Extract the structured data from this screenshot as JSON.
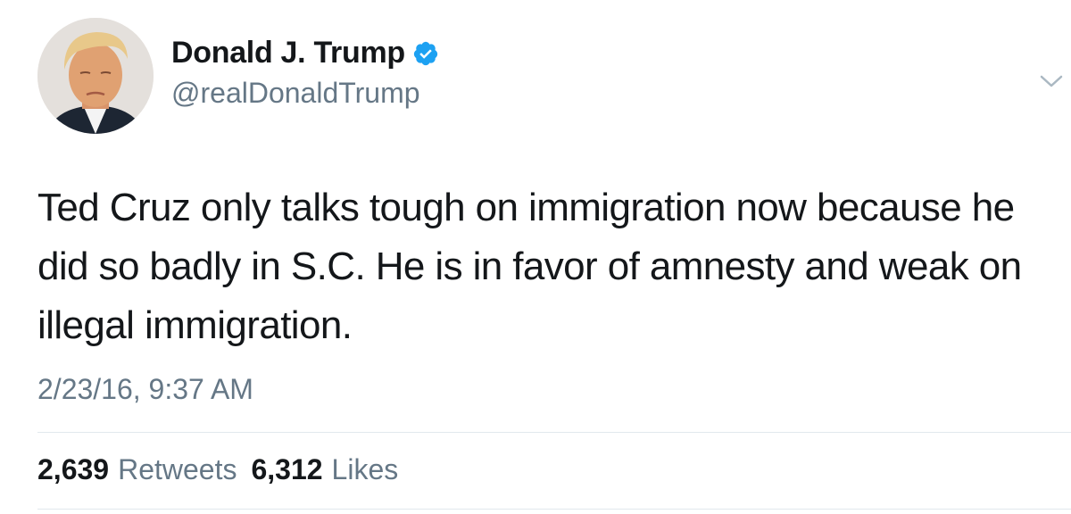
{
  "user": {
    "display_name": "Donald J. Trump",
    "handle": "@realDonaldTrump",
    "verified_icon": "verified-badge-icon",
    "avatar_icon": "profile-photo",
    "verified_color": "#1da1f2"
  },
  "menu": {
    "icon": "chevron-down-icon"
  },
  "tweet": {
    "text": "Ted Cruz only talks tough on immigration now because he did so badly in S.C. He is in favor of amnesty and weak on illegal immigration.",
    "timestamp": "2/23/16, 9:37 AM"
  },
  "stats": {
    "retweets_count": "2,639",
    "retweets_label": "Retweets",
    "likes_count": "6,312",
    "likes_label": "Likes"
  },
  "colors": {
    "text_primary": "#14171a",
    "text_secondary": "#657786",
    "divider": "#e1e8ed"
  }
}
